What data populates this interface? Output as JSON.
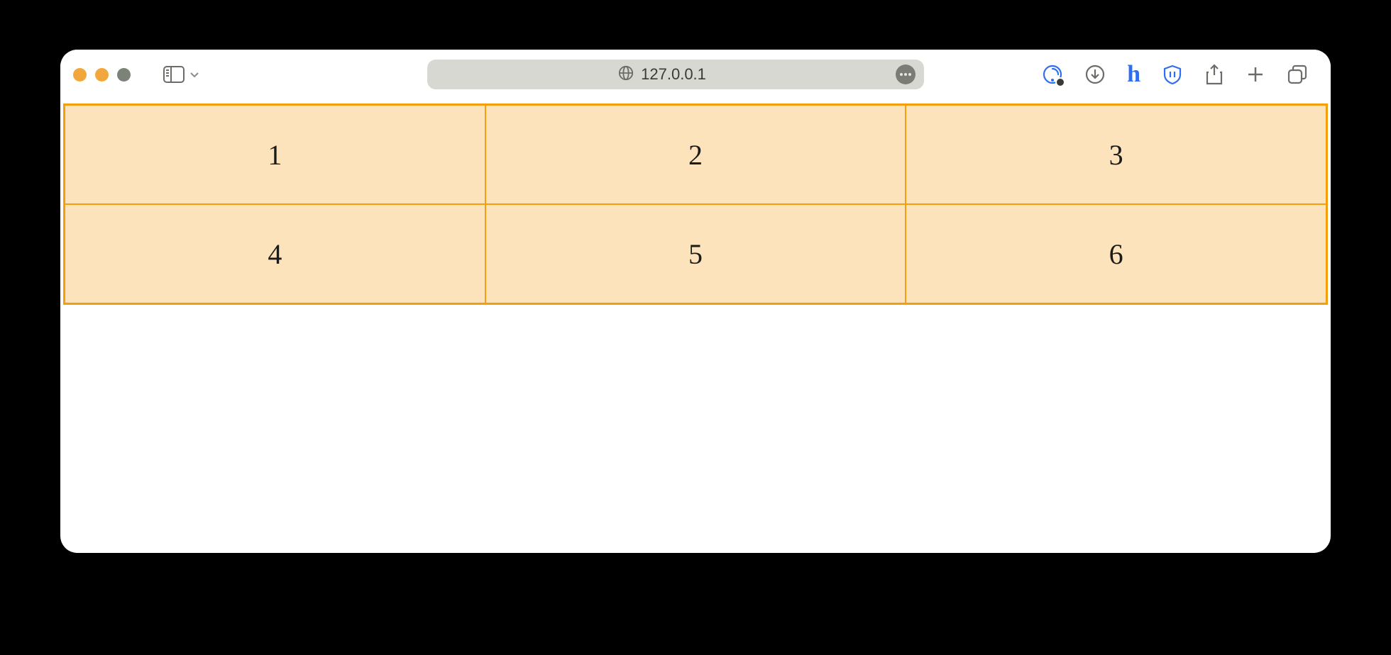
{
  "browser": {
    "address": "127.0.0.1",
    "traffic_lights": [
      "close",
      "minimize",
      "zoom"
    ]
  },
  "grid": {
    "cells": [
      "1",
      "2",
      "3",
      "4",
      "5",
      "6"
    ],
    "border_color": "#f59e0b",
    "cell_bg": "#fde3bb"
  }
}
